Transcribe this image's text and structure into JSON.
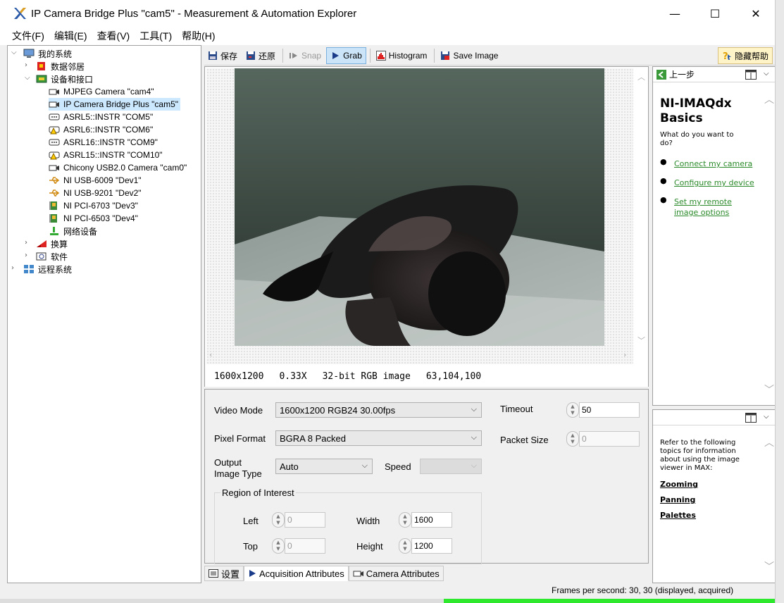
{
  "window": {
    "title": "IP Camera Bridge Plus  \"cam5\" - Measurement & Automation Explorer",
    "minimize": "—",
    "maximize": "☐",
    "close": "✕"
  },
  "menu": [
    "文件(F)",
    "编辑(E)",
    "查看(V)",
    "工具(T)",
    "帮助(H)"
  ],
  "tree": {
    "root": "我的系统",
    "data_neighborhood": "数据邻居",
    "devices": "设备和接口",
    "device_items": [
      "MJPEG Camera  \"cam4\"",
      "IP Camera Bridge Plus  \"cam5\"",
      "ASRL5::INSTR \"COM5\"",
      "ASRL6::INSTR \"COM6\"",
      "ASRL16::INSTR \"COM9\"",
      "ASRL15::INSTR \"COM10\"",
      "Chicony USB2.0 Camera  \"cam0\"",
      "NI USB-6009 \"Dev1\"",
      "NI USB-9201 \"Dev2\"",
      "NI PCI-6703 \"Dev3\"",
      "NI PCI-6503 \"Dev4\"",
      "网络设备"
    ],
    "scale": "换算",
    "software": "软件",
    "remote": "远程系统"
  },
  "toolbar": {
    "save": "保存",
    "restore": "还原",
    "snap": "Snap",
    "grab": "Grab",
    "histogram": "Histogram",
    "save_image": "Save Image",
    "hide_help": "隐藏帮助"
  },
  "viewer": {
    "resolution": "1600x1200",
    "zoom": "0.33X",
    "image_type": "32-bit RGB image",
    "pixel_value": "63,104,100"
  },
  "settings": {
    "video_mode_label": "Video Mode",
    "video_mode_value": "1600x1200 RGB24 30.00fps",
    "pixel_format_label": "Pixel Format",
    "pixel_format_value": "BGRA 8 Packed",
    "output_type_label1": "Output",
    "output_type_label2": "Image Type",
    "output_type_value": "Auto",
    "speed_label": "Speed",
    "speed_value": "",
    "timeout_label": "Timeout",
    "timeout_value": "50",
    "packet_size_label": "Packet Size",
    "packet_size_value": "0",
    "roi_label": "Region of Interest",
    "left_label": "Left",
    "left_value": "0",
    "top_label": "Top",
    "top_value": "0",
    "width_label": "Width",
    "width_value": "1600",
    "height_label": "Height",
    "height_value": "1200"
  },
  "tabs": [
    "设置",
    "Acquisition Attributes",
    "Camera Attributes"
  ],
  "help": {
    "back": "上一步",
    "title1": "NI-IMAQdx",
    "title2": "Basics",
    "question1": "What do you want to",
    "question2": "do?",
    "links": [
      "Connect my camera",
      "Configure my device",
      "Set my remote",
      "image options"
    ],
    "intro": [
      "Refer to the following",
      "topics for information",
      "about using the image",
      "viewer in MAX:"
    ],
    "topics": [
      "Zooming",
      "Panning",
      "Palettes"
    ]
  },
  "status": {
    "fps": "Frames per second: 30, 30 (displayed, acquired)"
  }
}
